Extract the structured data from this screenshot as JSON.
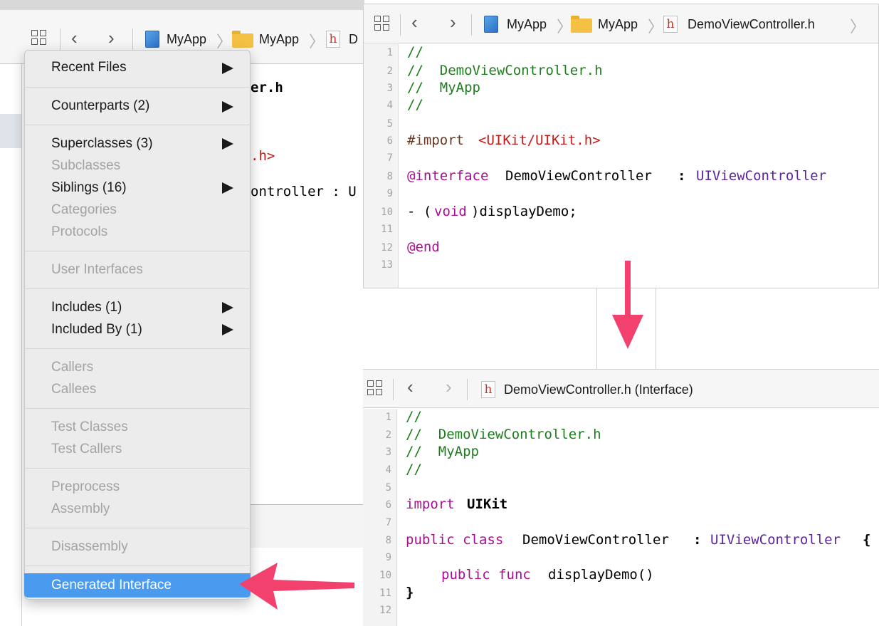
{
  "left_editor": {
    "breadcrumb": {
      "project": "MyApp",
      "group": "MyApp",
      "file_partial": "D"
    },
    "code_fragments": {
      "line_a": "er.h",
      "line_b": ".h>",
      "line_c": "ontroller : U"
    }
  },
  "menu": {
    "items": [
      {
        "label": "Recent Files"
      },
      {
        "label": "Counterparts (2)"
      },
      {
        "label": "Superclasses (3)"
      },
      {
        "label": "Subclasses"
      },
      {
        "label": "Siblings (16)"
      },
      {
        "label": "Categories"
      },
      {
        "label": "Protocols"
      },
      {
        "label": "User Interfaces"
      },
      {
        "label": "Includes (1)"
      },
      {
        "label": "Included By (1)"
      },
      {
        "label": "Callers"
      },
      {
        "label": "Callees"
      },
      {
        "label": "Test Classes"
      },
      {
        "label": "Test Callers"
      },
      {
        "label": "Preprocess"
      },
      {
        "label": "Assembly"
      },
      {
        "label": "Disassembly"
      },
      {
        "label": "Generated Interface"
      }
    ]
  },
  "top_editor": {
    "breadcrumb": {
      "project": "MyApp",
      "group": "MyApp",
      "file": "DemoViewController.h"
    },
    "line_numbers": [
      "1",
      "2",
      "3",
      "4",
      "5",
      "6",
      "7",
      "8",
      "9",
      "10",
      "11",
      "12",
      "13"
    ],
    "code": {
      "l1": "//",
      "l2": "//  DemoViewController.h",
      "l3": "//  MyApp",
      "l4": "//",
      "l6_kw": "#import",
      "l6_str": "<UIKit/UIKit.h>",
      "l8_kw": "@interface",
      "l8_name": "DemoViewController",
      "l8_colon": ":",
      "l8_super": "UIViewController",
      "l10_a": "- (",
      "l10_void": "void",
      "l10_b": ")displayDemo;",
      "l12": "@end"
    }
  },
  "bottom_editor": {
    "breadcrumb": {
      "file": "DemoViewController.h (Interface)"
    },
    "line_numbers": [
      "1",
      "2",
      "3",
      "4",
      "5",
      "6",
      "7",
      "8",
      "9",
      "10",
      "11",
      "12"
    ],
    "code": {
      "l1": "//",
      "l2": "//  DemoViewController.h",
      "l3": "//  MyApp",
      "l4": "//",
      "l6_kw": "import",
      "l6_mod": "UIKit",
      "l8_kw": "public class",
      "l8_name": "DemoViewController",
      "l8_colon": ":",
      "l8_super": "UIViewController",
      "l8_brace": "{",
      "l10_kw": "public func",
      "l10_name": "displayDemo()",
      "l11": "}"
    }
  },
  "colors": {
    "arrow": "#f2416d",
    "highlight": "#4a9bf0",
    "comment": "#1f7c1f",
    "keyword": "#aa0d91",
    "type": "#5c2699",
    "string": "#c41a16"
  }
}
